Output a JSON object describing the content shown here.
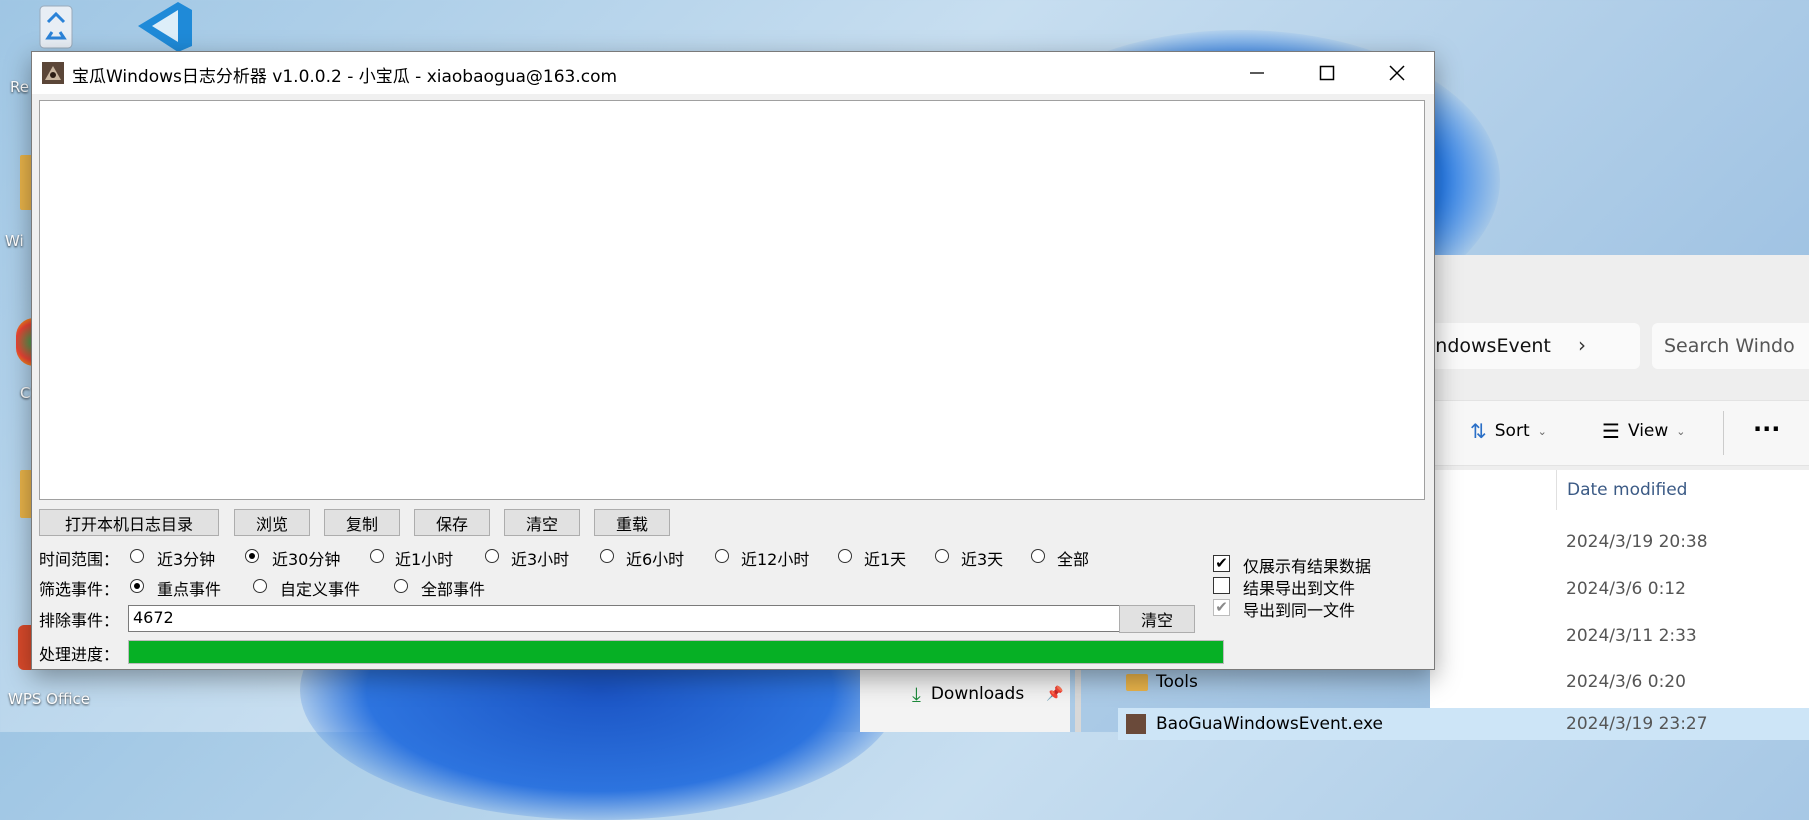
{
  "desktop": {
    "icons": [
      {
        "label": "Re"
      },
      {
        "label": "Wi"
      },
      {
        "label": "C"
      },
      {
        "label": "WPS Office"
      }
    ]
  },
  "explorer": {
    "breadcrumb": "indowsEvent",
    "search_placeholder": "Search Windo",
    "sort_label": "Sort",
    "view_label": "View",
    "column_date": "Date modified",
    "rows": [
      {
        "name": "",
        "date": "2024/3/19 20:38"
      },
      {
        "name": "",
        "date": "2024/3/6 0:12"
      },
      {
        "name": "",
        "date": "2024/3/11 2:33"
      },
      {
        "name": "Tools",
        "date": "2024/3/6 0:20"
      },
      {
        "name": "BaoGuaWindowsEvent.exe",
        "date": "2024/3/19 23:27"
      }
    ],
    "nav_downloads": "Downloads"
  },
  "window": {
    "title": "宝瓜Windows日志分析器 v1.0.0.2 - 小宝瓜 - xiaobaogua@163.com",
    "log_text": "",
    "buttons": {
      "open_dir": "打开本机日志目录",
      "browse": "浏览",
      "copy": "复制",
      "save": "保存",
      "clear": "清空",
      "reload": "重载"
    },
    "time_range": {
      "label": "时间范围：",
      "options": [
        "近3分钟",
        "近30分钟",
        "近1小时",
        "近3小时",
        "近6小时",
        "近12小时",
        "近1天",
        "近3天",
        "全部"
      ],
      "selected": "近30分钟"
    },
    "filter": {
      "label": "筛选事件：",
      "options": [
        "重点事件",
        "自定义事件",
        "全部事件"
      ],
      "selected": "重点事件"
    },
    "exclude": {
      "label": "排除事件：",
      "value": "4672",
      "clear_label": "清空"
    },
    "progress": {
      "label": "处理进度：",
      "value": 1.0,
      "color": "#06b025"
    },
    "checkboxes": [
      {
        "label": "仅展示有结果数据",
        "checked": true,
        "enabled": true
      },
      {
        "label": "结果导出到文件",
        "checked": false,
        "enabled": true
      },
      {
        "label": "导出到同一文件",
        "checked": true,
        "enabled": false
      }
    ]
  }
}
